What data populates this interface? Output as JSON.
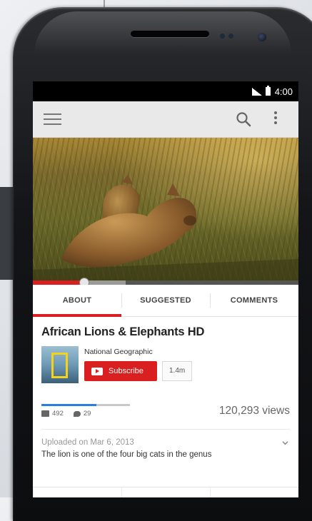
{
  "status_bar": {
    "time": "4:00"
  },
  "app_bar": {
    "menu_icon": "hamburger-icon",
    "search_icon": "search-icon",
    "overflow_icon": "more-vert-icon"
  },
  "player": {
    "progress_fraction": 0.19,
    "buffered_fraction": 0.35
  },
  "tabs": [
    {
      "label": "ABOUT",
      "active": true
    },
    {
      "label": "SUGGESTED",
      "active": false
    },
    {
      "label": "COMMENTS",
      "active": false
    }
  ],
  "video": {
    "title": "African Lions & Elephants HD",
    "channel": "National Geographic",
    "subscribe_label": "Subscribe",
    "subscriber_count": "1.4m",
    "likes": "492",
    "comments": "29",
    "like_fraction": 0.62,
    "views": "120,293 views",
    "uploaded": "Uploaded on Mar 6, 2013",
    "description": "The lion is one of the four big cats in the genus"
  },
  "colors": {
    "accent": "#d91f1f",
    "like_bar": "#2a7fde"
  }
}
